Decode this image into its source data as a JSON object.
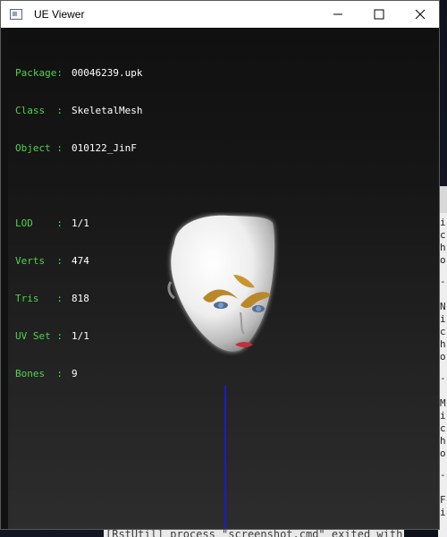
{
  "window": {
    "title": "UE Viewer"
  },
  "info": {
    "package": {
      "label": "Package:",
      "value": "00046239.upk"
    },
    "class": {
      "label": "Class  :",
      "value": "SkeletalMesh"
    },
    "object": {
      "label": "Object :",
      "value": "010122_JinF"
    },
    "lod": {
      "label": "LOD    :",
      "value": "1/1"
    },
    "verts": {
      "label": "Verts  :",
      "value": "474"
    },
    "tris": {
      "label": "Tris   :",
      "value": "818"
    },
    "uvset": {
      "label": "UV Set :",
      "value": "1/1"
    },
    "bones": {
      "label": "Bones  :",
      "value": "9"
    }
  },
  "background": {
    "terminal_lines": [
      "i",
      "c",
      "h",
      "o",
      "-",
      "N",
      "i",
      "c",
      "h",
      "o",
      "-",
      "M",
      "i",
      "c",
      "h",
      "o",
      "-",
      "F",
      "i"
    ],
    "left_sliver": "M",
    "bottom_log": "[RstUtil] process \"screenshot.cmd\" exited with"
  },
  "colors": {
    "label_green": "#4cd44c",
    "axis_blue": "#1c1cc8"
  },
  "icons": {
    "app": "window-app-icon",
    "min": "minimize-icon",
    "max": "maximize-icon",
    "close": "close-icon"
  }
}
